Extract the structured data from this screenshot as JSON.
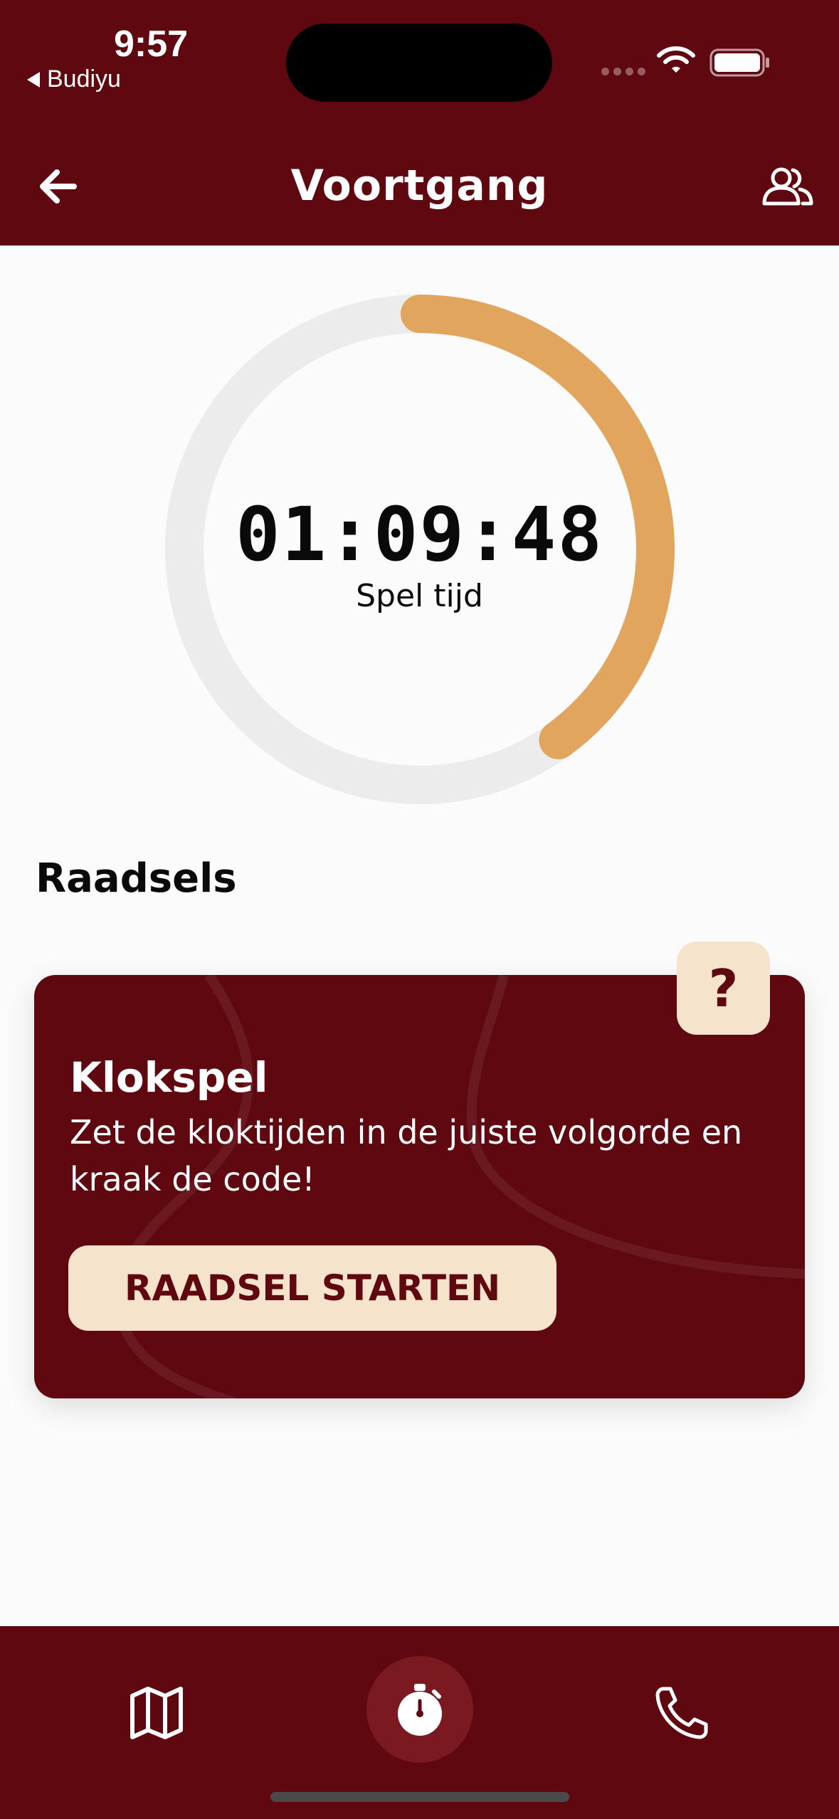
{
  "status_bar": {
    "time": "9:57",
    "back_app": "Budiyu",
    "icons": [
      "signal-dots-icon",
      "wifi-icon",
      "battery-icon"
    ]
  },
  "nav": {
    "title": "Voortgang",
    "back_icon": "arrow-left-icon",
    "team_icon": "people-icon"
  },
  "progress": {
    "timer": "01:09:48",
    "label": "Spel tijd",
    "fraction": 0.4,
    "color_track": "#ececec",
    "color_fill": "#e2a55e"
  },
  "puzzles": {
    "section_title": "Raadsels",
    "card": {
      "title": "Klokspel",
      "description": "Zet de kloktijden in de juiste volgorde en kraak de code!",
      "button_label": "RAADSEL STARTEN",
      "badge": "?"
    }
  },
  "tab_bar": {
    "items": [
      {
        "icon": "map-icon"
      },
      {
        "icon": "stopwatch-icon",
        "active": true
      },
      {
        "icon": "phone-icon"
      }
    ]
  },
  "colors": {
    "brand": "#5f0810",
    "cream": "#f5e4cb",
    "accent": "#e2a55e"
  }
}
